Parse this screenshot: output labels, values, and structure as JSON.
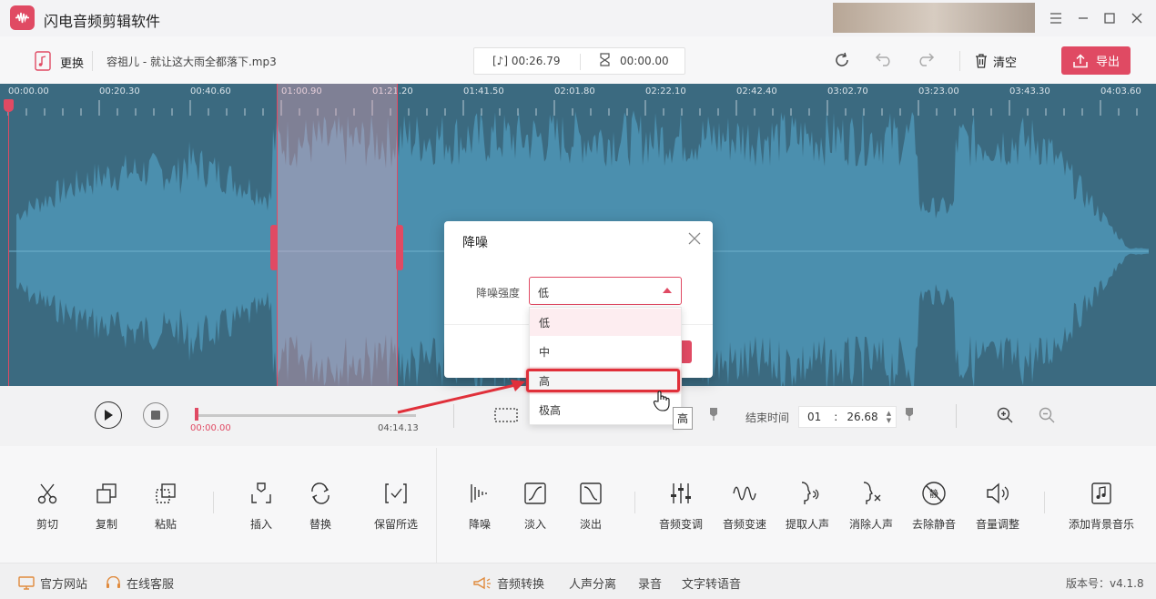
{
  "app": {
    "title": "闪电音频剪辑软件"
  },
  "toolbar": {
    "change_label": "更换",
    "file_name": "容祖儿 - 就让这大雨全都落下.mp3",
    "duration": "26.79",
    "duration_prefix": "[♪] 00:",
    "current_time": "00:00.00",
    "clear_label": "清空",
    "export_label": "导出"
  },
  "ruler": {
    "labels": [
      "00:00.00",
      "00:20.30",
      "00:40.60",
      "01:00.90",
      "01:21.20",
      "01:41.50",
      "02:01.80",
      "02:22.10",
      "02:42.40",
      "03:02.70",
      "03:23.00",
      "03:43.30",
      "04:03.60"
    ]
  },
  "transport": {
    "start_time": "00:00.00",
    "end_time": "04:14.13",
    "end_label": "结束时间",
    "end_min": "01",
    "end_sec": "26.68",
    "colon": ":"
  },
  "tools": {
    "items": [
      {
        "label": "剪切",
        "icon": "scissors-icon"
      },
      {
        "label": "复制",
        "icon": "copy-icon"
      },
      {
        "label": "粘贴",
        "icon": "paste-icon"
      },
      {
        "label": "插入",
        "icon": "insert-icon"
      },
      {
        "label": "替换",
        "icon": "replace-icon"
      },
      {
        "label": "保留所选",
        "icon": "keep-selection-icon"
      },
      {
        "label": "降噪",
        "icon": "noise-reduction-icon"
      },
      {
        "label": "淡入",
        "icon": "fade-in-icon"
      },
      {
        "label": "淡出",
        "icon": "fade-out-icon"
      },
      {
        "label": "音频变调",
        "icon": "pitch-icon"
      },
      {
        "label": "音频变速",
        "icon": "speed-icon"
      },
      {
        "label": "提取人声",
        "icon": "extract-voice-icon"
      },
      {
        "label": "消除人声",
        "icon": "remove-voice-icon"
      },
      {
        "label": "去除静音",
        "icon": "remove-silence-icon"
      },
      {
        "label": "音量调整",
        "icon": "volume-icon"
      },
      {
        "label": "添加背景音乐",
        "icon": "music-note-icon"
      }
    ]
  },
  "status": {
    "website": "官方网站",
    "support": "在线客服",
    "convert": "音频转换",
    "separate": "人声分离",
    "record": "录音",
    "tts": "文字转语音",
    "version": "版本号：v4.1.8"
  },
  "dialog": {
    "title": "降噪",
    "strength_label": "降噪强度",
    "selected": "低",
    "options": [
      "低",
      "中",
      "高",
      "极高"
    ],
    "hover_index": 2,
    "tooltip": "高"
  },
  "colors": {
    "accent": "#e04a63",
    "waveform": "#4b8fae",
    "waveform_bg": "#3b6a80"
  }
}
